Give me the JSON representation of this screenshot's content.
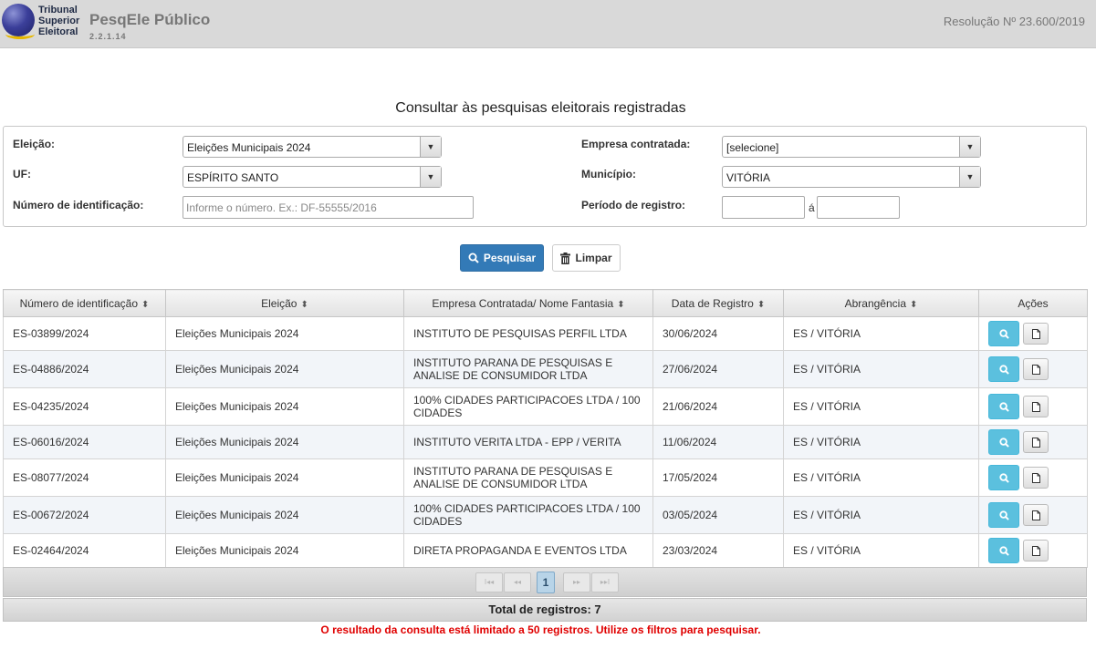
{
  "header": {
    "logo_lines": [
      "Tribunal",
      "Superior",
      "Eleitoral"
    ],
    "app_title": "PesqEle Público",
    "version": "2.2.1.14",
    "resolution": "Resolução Nº 23.600/2019"
  },
  "page_heading": "Consultar às pesquisas eleitorais registradas",
  "filters": {
    "eleicao": {
      "label": "Eleição:",
      "value": "Eleições Municipais 2024"
    },
    "uf": {
      "label": "UF:",
      "value": "ESPÍRITO SANTO"
    },
    "numero": {
      "label": "Número de identificação:",
      "value": "",
      "placeholder": "Informe o número. Ex.: DF-55555/2016"
    },
    "empresa": {
      "label": "Empresa contratada:",
      "value": "[selecione]"
    },
    "municipio": {
      "label": "Município:",
      "value": "VITÓRIA"
    },
    "periodo": {
      "label": "Período de registro:",
      "separator": "á",
      "start": "",
      "end": ""
    }
  },
  "buttons": {
    "search": "Pesquisar",
    "clear": "Limpar"
  },
  "table": {
    "columns": [
      "Número de identificação",
      "Eleição",
      "Empresa Contratada/ Nome Fantasia",
      "Data de Registro",
      "Abrangência",
      "Ações"
    ],
    "rows": [
      {
        "numero": "ES-03899/2024",
        "eleicao": "Eleições Municipais 2024",
        "empresa": "INSTITUTO DE PESQUISAS PERFIL LTDA",
        "data": "30/06/2024",
        "abrangencia": "ES / VITÓRIA"
      },
      {
        "numero": "ES-04886/2024",
        "eleicao": "Eleições Municipais 2024",
        "empresa": "INSTITUTO PARANA DE PESQUISAS E ANALISE DE CONSUMIDOR LTDA",
        "data": "27/06/2024",
        "abrangencia": "ES / VITÓRIA"
      },
      {
        "numero": "ES-04235/2024",
        "eleicao": "Eleições Municipais 2024",
        "empresa": "100% CIDADES PARTICIPACOES LTDA / 100 CIDADES",
        "data": "21/06/2024",
        "abrangencia": "ES / VITÓRIA"
      },
      {
        "numero": "ES-06016/2024",
        "eleicao": "Eleições Municipais 2024",
        "empresa": "INSTITUTO VERITA LTDA - EPP / VERITA",
        "data": "11/06/2024",
        "abrangencia": "ES / VITÓRIA"
      },
      {
        "numero": "ES-08077/2024",
        "eleicao": "Eleições Municipais 2024",
        "empresa": "INSTITUTO PARANA DE PESQUISAS E ANALISE DE CONSUMIDOR LTDA",
        "data": "17/05/2024",
        "abrangencia": "ES / VITÓRIA"
      },
      {
        "numero": "ES-00672/2024",
        "eleicao": "Eleições Municipais 2024",
        "empresa": "100% CIDADES PARTICIPACOES LTDA / 100 CIDADES",
        "data": "03/05/2024",
        "abrangencia": "ES / VITÓRIA"
      },
      {
        "numero": "ES-02464/2024",
        "eleicao": "Eleições Municipais 2024",
        "empresa": "DIRETA PROPAGANDA E EVENTOS LTDA",
        "data": "23/03/2024",
        "abrangencia": "ES / VITÓRIA"
      }
    ]
  },
  "pager": {
    "current_page": "1"
  },
  "total": "Total de registros: 7",
  "limit_note": "O resultado da consulta está limitado a 50 registros. Utilize os filtros para pesquisar.",
  "colors": {
    "primary": "#337ab7",
    "info": "#5bc0de",
    "warning_text": "#e00000",
    "header_bg": "#d9d9d9"
  },
  "icons": {
    "search": "search-icon",
    "clear": "trash-icon",
    "view": "search-icon",
    "document": "document-icon",
    "sort": "sort-icon"
  }
}
